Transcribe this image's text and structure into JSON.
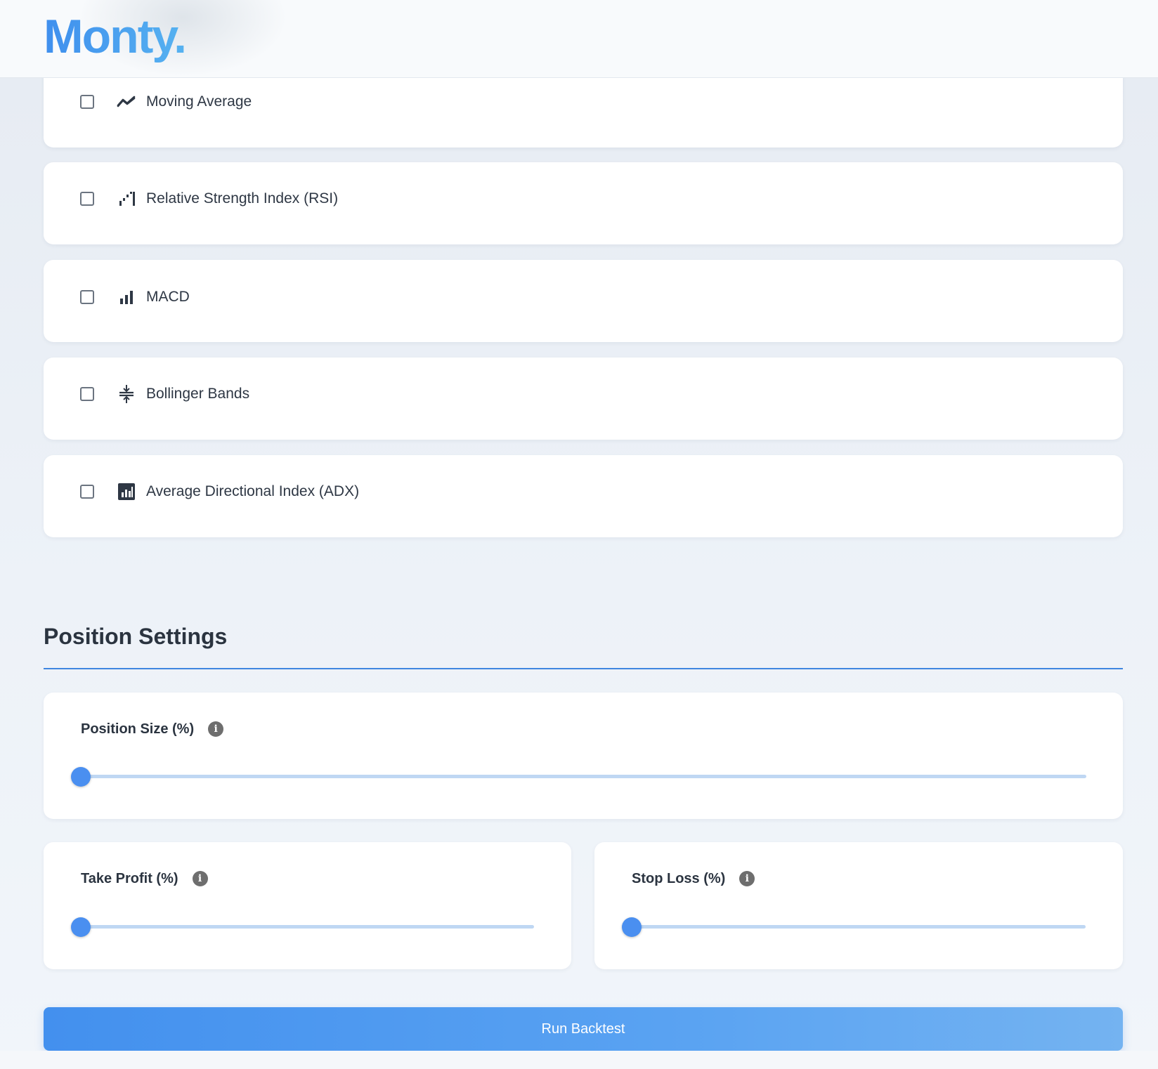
{
  "app": {
    "logo_text": "Monty",
    "logo_dot": "."
  },
  "indicators": [
    {
      "label": "Moving Average",
      "icon": "trend-line-icon",
      "checked": false
    },
    {
      "label": "Relative Strength Index (RSI)",
      "icon": "signal-bars-icon",
      "checked": false
    },
    {
      "label": "MACD",
      "icon": "bar-chart-icon",
      "checked": false
    },
    {
      "label": "Bollinger Bands",
      "icon": "compress-vertical-icon",
      "checked": false
    },
    {
      "label": "Average Directional Index (ADX)",
      "icon": "analytics-box-icon",
      "checked": false
    }
  ],
  "position_settings": {
    "title": "Position Settings",
    "position_size": {
      "label": "Position Size (%)",
      "info": "i",
      "value_fraction": 0
    },
    "take_profit": {
      "label": "Take Profit (%)",
      "info": "i",
      "value_fraction": 0
    },
    "stop_loss": {
      "label": "Stop Loss (%)",
      "info": "i",
      "value_fraction": 0
    }
  },
  "actions": {
    "run_label": "Run Backtest"
  },
  "colors": {
    "brand": "#4a9bef",
    "accent": "#3f86e0",
    "slider_thumb": "#4a8ff0",
    "slider_track": "#bfd7f3"
  }
}
